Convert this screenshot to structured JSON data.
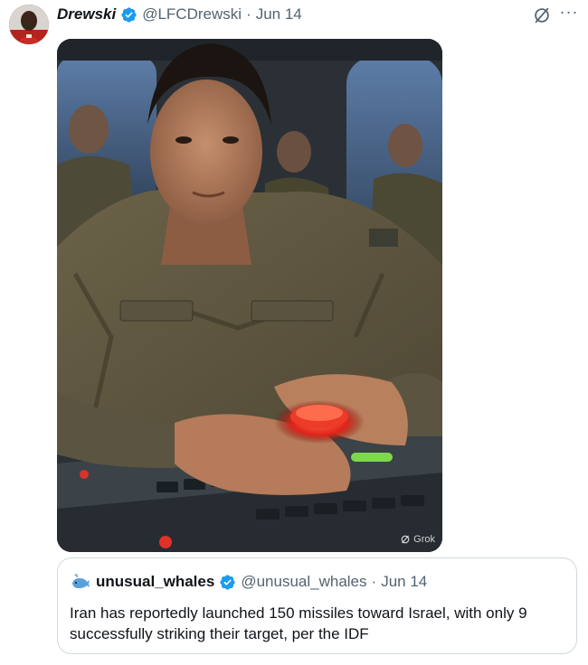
{
  "tweet": {
    "author": {
      "display_name": "Drewski",
      "handle": "@LFCDrewski",
      "verified": true,
      "avatar_icon": "user-avatar"
    },
    "separator": "·",
    "date": "Jun 14",
    "actions": {
      "grok_icon": "grok-icon",
      "more_label": "···"
    },
    "media": {
      "watermark": "Grok",
      "watermark_icon": "grok-icon"
    },
    "quote": {
      "author": {
        "display_name": "unusual_whales",
        "handle": "@unusual_whales",
        "verified": true,
        "avatar_icon": "whale-icon"
      },
      "separator": "·",
      "date": "Jun 14",
      "text": "Iran has reportedly launched 150 missiles toward Israel, with only 9 successfully striking their target, per the IDF"
    }
  },
  "colors": {
    "verified": "#1d9bf0",
    "secondary_text": "#536471",
    "border": "#cfd9de"
  }
}
